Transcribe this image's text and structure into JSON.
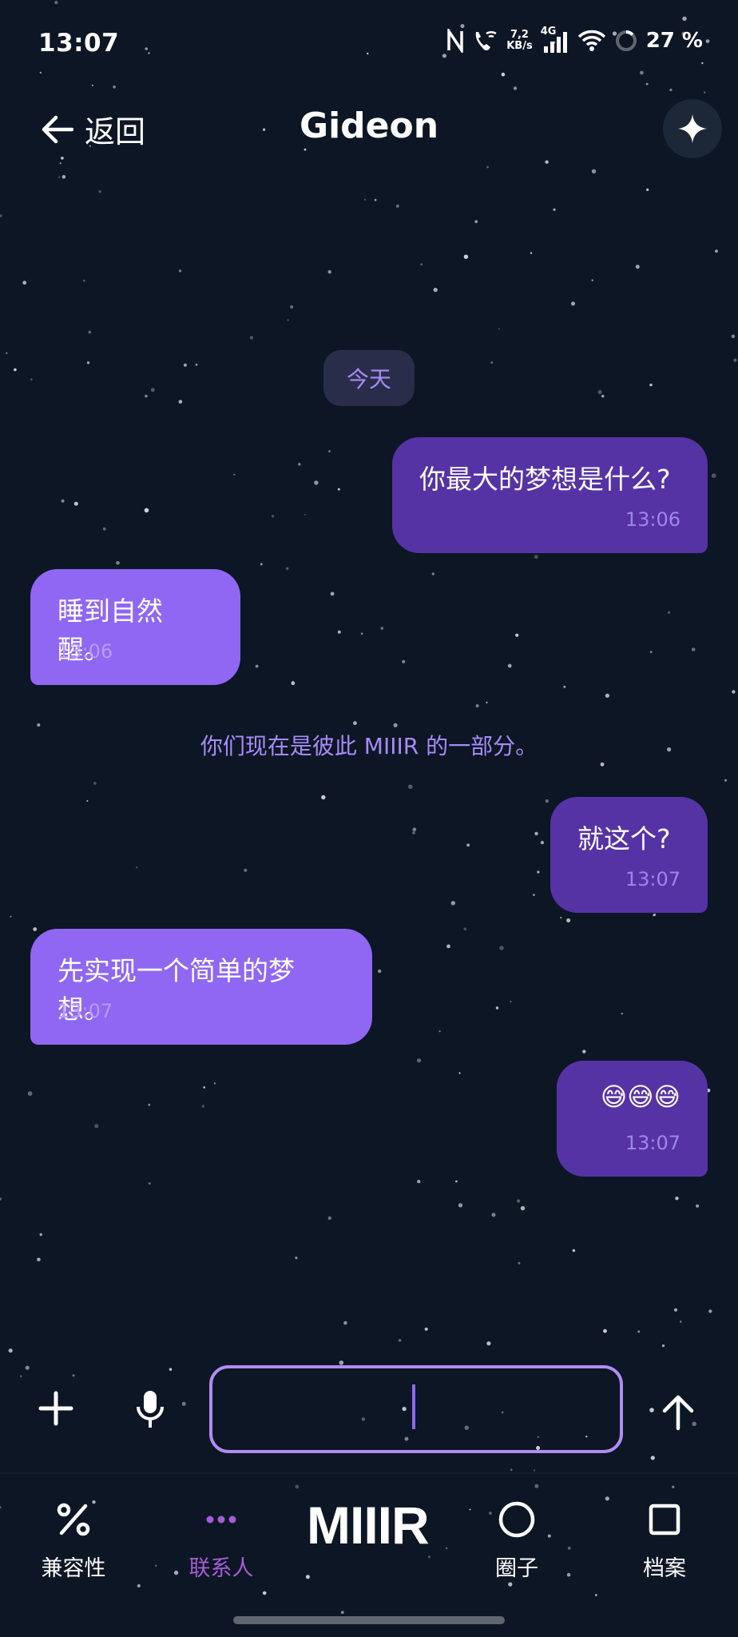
{
  "status_bar": {
    "time": "13:07",
    "speed_value": "7,2",
    "speed_unit": "KB/s",
    "network": "4G",
    "battery": "27 %"
  },
  "header": {
    "back_label": "返回",
    "title": "Gideon"
  },
  "chat": {
    "date_chip": "今天",
    "messages": [
      {
        "direction": "outgoing",
        "text": "你最大的梦想是什么?",
        "time": "13:06"
      },
      {
        "direction": "incoming",
        "text": "睡到自然醒。",
        "time": "13:06"
      },
      {
        "direction": "outgoing",
        "text": "就这个?",
        "time": "13:07"
      },
      {
        "direction": "incoming",
        "text": "先实现一个简单的梦想。",
        "time": "13:07"
      },
      {
        "direction": "outgoing",
        "text": "😅😅😅",
        "time": "13:07"
      }
    ],
    "system_notice": "你们现在是彼此 MIIIR 的一部分。"
  },
  "composer": {
    "input_value": "",
    "placeholder": ""
  },
  "bottom_nav": {
    "logo": "MIIIR",
    "items": [
      {
        "label": "兼容性",
        "icon": "percent-icon"
      },
      {
        "label": "联系人",
        "icon": "dots-icon",
        "active": true
      },
      {
        "label": "圈子",
        "icon": "circle-icon"
      },
      {
        "label": "档案",
        "icon": "square-icon"
      }
    ]
  },
  "colors": {
    "background": "#0c1624",
    "outgoing_bubble": "#5533a5",
    "incoming_bubble": "#8f67f3",
    "accent": "#a78bfa",
    "active_nav": "#a55cd6"
  }
}
